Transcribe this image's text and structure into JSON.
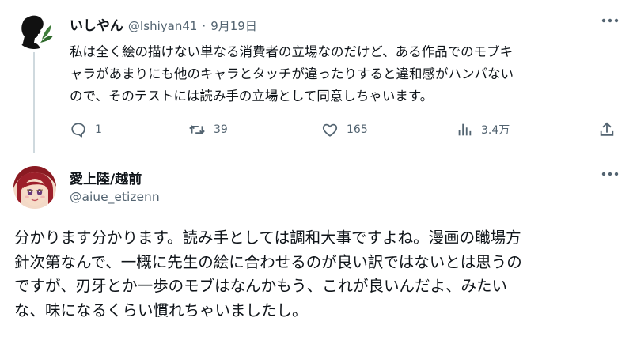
{
  "tweet1": {
    "display_name": "いしやん",
    "handle": "@Ishiyan41",
    "separator": "·",
    "date": "9月19日",
    "more_icon": "more-horizontal-icon",
    "body_lines": [
      "私は全く絵の描けない単なる消費者の立場なのだけど、ある作品でのモブキ",
      "ャラがあまりにも他のキャラとタッチが違ったりすると違和感がハンパない",
      "ので、そのテストには読み手の立場として同意しちゃいます。"
    ],
    "actions": {
      "reply_count": "1",
      "retweet_count": "39",
      "like_count": "165",
      "views_count": "3.4万"
    }
  },
  "tweet2": {
    "display_name": "愛上陸/越前",
    "handle": "@aiue_etizenn",
    "more_icon": "more-horizontal-icon",
    "body_lines": [
      "分かります分かります。読み手としては調和大事ですよね。漫画の職場方",
      "針次第なんで、一概に先生の絵に合わせるのが良い訳ではないとは思うの",
      "ですが、刃牙とか一歩のモブはなんかもう、これが良いんだよ、みたい",
      "な、味になるくらい慣れちゃいましたし。"
    ]
  },
  "colors": {
    "text": "#0f1419",
    "secondary": "#536471",
    "thread_line": "#cfd9de"
  }
}
